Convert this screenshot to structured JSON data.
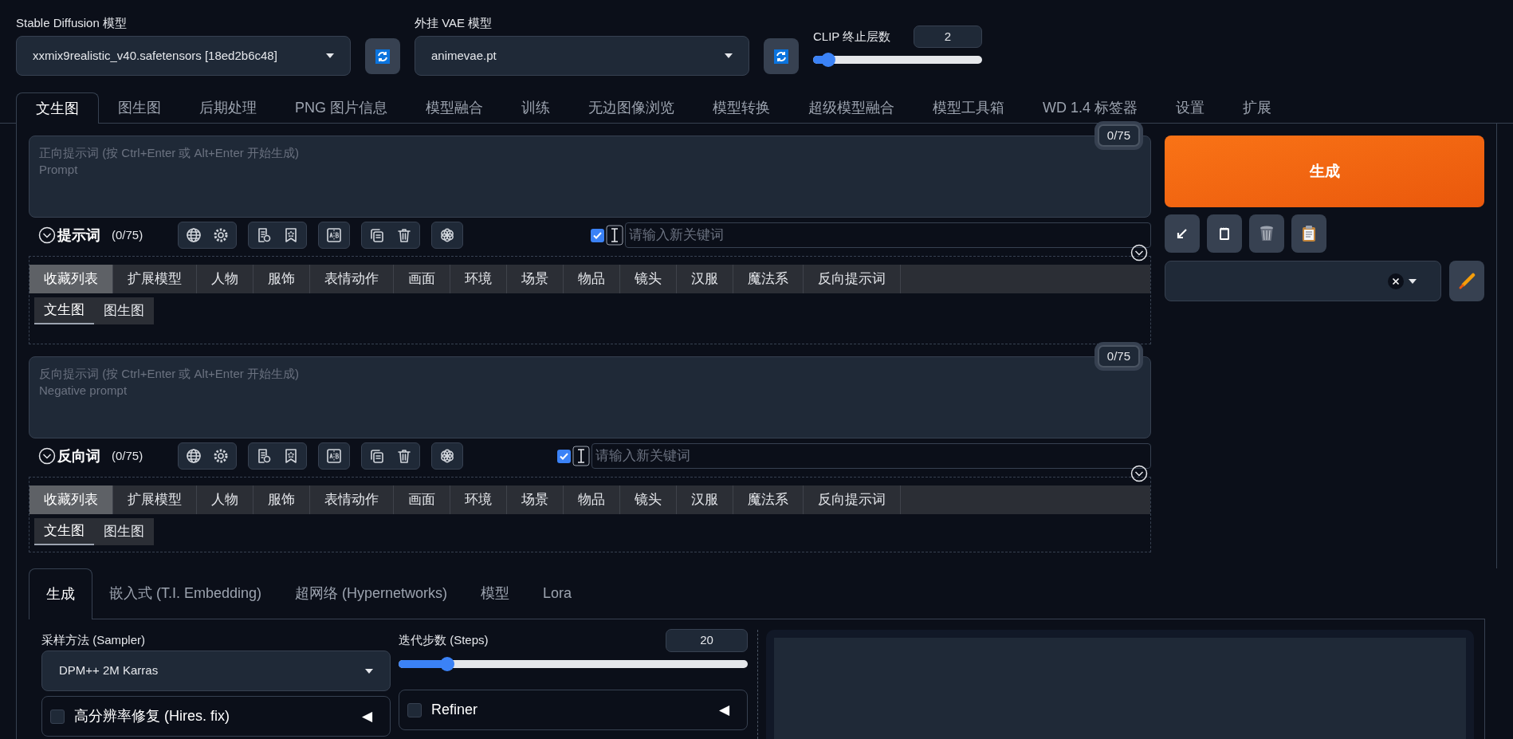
{
  "models": [
    {
      "label": "Stable Diffusion 模型",
      "value": "xxmix9realistic_v40.safetensors [18ed2b6c48]"
    },
    {
      "label": "外挂 VAE 模型",
      "value": "animevae.pt"
    }
  ],
  "clip_skip": {
    "label": "CLIP 终止层数",
    "value": "2",
    "level": 0.09
  },
  "main_tabs": [
    {
      "label": "文生图",
      "selected": true
    },
    {
      "label": "图生图",
      "selected": false
    },
    {
      "label": "后期处理",
      "selected": false
    },
    {
      "label": "PNG 图片信息",
      "selected": false
    },
    {
      "label": "模型融合",
      "selected": false
    },
    {
      "label": "训练",
      "selected": false
    },
    {
      "label": "无边图像浏览",
      "selected": false
    },
    {
      "label": "模型转换",
      "selected": false
    },
    {
      "label": "超级模型融合",
      "selected": false
    },
    {
      "label": "模型工具箱",
      "selected": false
    },
    {
      "label": "WD 1.4 标签器",
      "selected": false
    },
    {
      "label": "设置",
      "selected": false
    },
    {
      "label": "扩展",
      "selected": false
    }
  ],
  "prompts": [
    {
      "counter": "0/75",
      "placeholder": "正向提示词 (按 Ctrl+Enter 或 Alt+Enter 开始生成)\nPrompt",
      "title": "提示词",
      "count": "(0/75)",
      "keyword_enabled": true,
      "keyword_placeholder": "请输入新关键词",
      "categories": [
        {
          "label": "收藏列表",
          "selected": true
        },
        {
          "label": "扩展模型",
          "selected": false
        },
        {
          "label": "人物",
          "selected": false
        },
        {
          "label": "服饰",
          "selected": false
        },
        {
          "label": "表情动作",
          "selected": false
        },
        {
          "label": "画面",
          "selected": false
        },
        {
          "label": "环境",
          "selected": false
        },
        {
          "label": "场景",
          "selected": false
        },
        {
          "label": "物品",
          "selected": false
        },
        {
          "label": "镜头",
          "selected": false
        },
        {
          "label": "汉服",
          "selected": false
        },
        {
          "label": "魔法系",
          "selected": false
        },
        {
          "label": "反向提示词",
          "selected": false
        }
      ],
      "subtabs": [
        {
          "label": "文生图",
          "selected": true
        },
        {
          "label": "图生图",
          "selected": false
        }
      ]
    },
    {
      "counter": "0/75",
      "placeholder": "反向提示词 (按 Ctrl+Enter 或 Alt+Enter 开始生成)\nNegative prompt",
      "title": "反向词",
      "count": "(0/75)",
      "keyword_enabled": true,
      "keyword_placeholder": "请输入新关键词",
      "categories": [
        {
          "label": "收藏列表",
          "selected": true
        },
        {
          "label": "扩展模型",
          "selected": false
        },
        {
          "label": "人物",
          "selected": false
        },
        {
          "label": "服饰",
          "selected": false
        },
        {
          "label": "表情动作",
          "selected": false
        },
        {
          "label": "画面",
          "selected": false
        },
        {
          "label": "环境",
          "selected": false
        },
        {
          "label": "场景",
          "selected": false
        },
        {
          "label": "物品",
          "selected": false
        },
        {
          "label": "镜头",
          "selected": false
        },
        {
          "label": "汉服",
          "selected": false
        },
        {
          "label": "魔法系",
          "selected": false
        },
        {
          "label": "反向提示词",
          "selected": false
        }
      ],
      "subtabs": [
        {
          "label": "文生图",
          "selected": true
        },
        {
          "label": "图生图",
          "selected": false
        }
      ]
    }
  ],
  "generate_button": "生成",
  "settings_tabs": [
    {
      "label": "生成",
      "selected": true
    },
    {
      "label": "嵌入式 (T.I. Embedding)",
      "selected": false
    },
    {
      "label": "超网络 (Hypernetworks)",
      "selected": false
    },
    {
      "label": "模型",
      "selected": false
    },
    {
      "label": "Lora",
      "selected": false
    }
  ],
  "sampler": {
    "label": "采样方法 (Sampler)",
    "value": "DPM++ 2M Karras"
  },
  "steps": {
    "label": "迭代步数 (Steps)",
    "value": "20",
    "level": 0.14
  },
  "accordions": [
    {
      "label": "高分辨率修复 (Hires. fix)",
      "checked": false,
      "arrow": "◀"
    },
    {
      "label": "Refiner",
      "checked": false,
      "arrow": "◀"
    }
  ]
}
